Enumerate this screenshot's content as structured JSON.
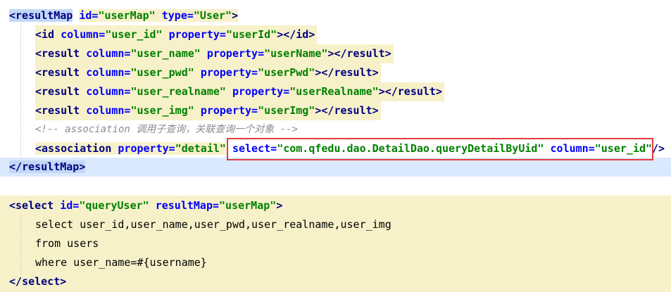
{
  "editor": {
    "lines": [
      {
        "lt": "<",
        "tag": "resultMap",
        "a1": "id=",
        "v1": "\"userMap\"",
        "a2": "type=",
        "v2": "\"User\"",
        "gt": ">"
      },
      {
        "lt": "<",
        "tag": "id",
        "a1": "column=",
        "v1": "\"user_id\"",
        "a2": "property=",
        "v2": "\"userId\"",
        "close": "></",
        "ctag": "id",
        "gt": ">"
      },
      {
        "lt": "<",
        "tag": "result",
        "a1": "column=",
        "v1": "\"user_name\"",
        "a2": "property=",
        "v2": "\"userName\"",
        "close": "></",
        "ctag": "result",
        "gt": ">"
      },
      {
        "lt": "<",
        "tag": "result",
        "a1": "column=",
        "v1": "\"user_pwd\"",
        "a2": "property=",
        "v2": "\"userPwd\"",
        "close": "></",
        "ctag": "result",
        "gt": ">"
      },
      {
        "lt": "<",
        "tag": "result",
        "a1": "column=",
        "v1": "\"user_realname\"",
        "a2": "property=",
        "v2": "\"userRealname\"",
        "close": "></",
        "ctag": "result",
        "gt": ">"
      },
      {
        "lt": "<",
        "tag": "result",
        "a1": "column=",
        "v1": "\"user_img\"",
        "a2": "property=",
        "v2": "\"userImg\"",
        "close": "></",
        "ctag": "result",
        "gt": ">"
      },
      {
        "comment": "<!-- association 调用子查询，关联查询一个对象 -->"
      },
      {
        "lt": "<",
        "tag": "association",
        "a1": "property=",
        "v1": "\"detail\"",
        "a2": "select=",
        "v2": "\"com.qfedu.dao.DetailDao.queryDetailByUid\"",
        "a3": "column=",
        "v3": "\"user_id\"",
        "gt": "/>"
      },
      {
        "lt": "</",
        "tag": "resultMap",
        "gt": ">"
      },
      {
        "lt": "<",
        "tag": "select",
        "a1": "id=",
        "v1": "\"queryUser\"",
        "a2": "resultMap=",
        "v2": "\"userMap\"",
        "gt": ">"
      },
      {
        "sql": "select user_id,user_name,user_pwd,user_realname,user_img"
      },
      {
        "sql": "from users"
      },
      {
        "sql": "where user_name=#{username}"
      },
      {
        "lt": "</",
        "tag": "select",
        "gt": ">"
      }
    ]
  },
  "colors": {
    "tag": "#000080",
    "attribute": "#0000ff",
    "value": "#008000",
    "comment": "#8c8c8c",
    "highlight_yellow": "#f7f1c9",
    "highlight_blue": "#dbe9ff",
    "annotation_box": "#e43b3b"
  }
}
